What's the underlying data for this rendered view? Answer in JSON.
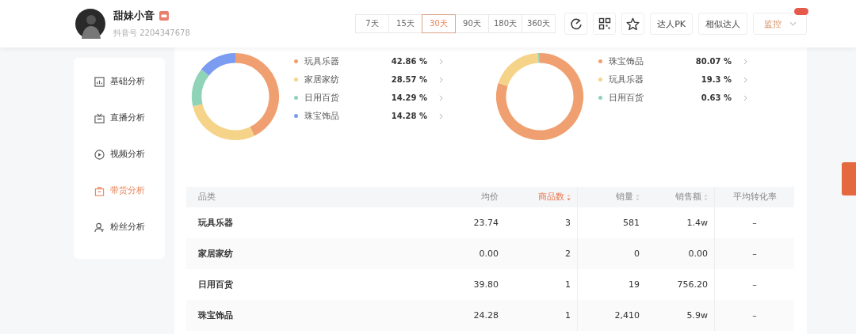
{
  "profile": {
    "name": "甜妹小音",
    "account": "抖音号 2204347678"
  },
  "periods": [
    {
      "label": "7天",
      "selected": false
    },
    {
      "label": "15天",
      "selected": false
    },
    {
      "label": "30天",
      "selected": true
    },
    {
      "label": "90天",
      "selected": false
    },
    {
      "label": "180天",
      "selected": false
    },
    {
      "label": "360天",
      "selected": false
    }
  ],
  "actions": [
    {
      "label": "达人PK"
    },
    {
      "label": "相似达人"
    }
  ],
  "monitor": {
    "label": "监控"
  },
  "sidebar": {
    "items": [
      {
        "label": "基础分析",
        "kind": "chart",
        "selected": false
      },
      {
        "label": "直播分析",
        "kind": "live",
        "selected": false
      },
      {
        "label": "视频分析",
        "kind": "video",
        "selected": false
      },
      {
        "label": "带货分析",
        "kind": "goods",
        "selected": true
      },
      {
        "label": "粉丝分析",
        "kind": "fans",
        "selected": false
      }
    ]
  },
  "charts": [
    {
      "chart_data": {
        "type": "donut",
        "categories": [
          "玩具乐器",
          "家居家纺",
          "日用百货",
          "珠宝饰品"
        ],
        "values": [
          42.86,
          28.57,
          14.29,
          14.28
        ]
      },
      "legend": [
        {
          "value": "42.86 %",
          "color": "#f0a070"
        },
        {
          "value": "28.57 %",
          "color": "#f5d388"
        },
        {
          "value": "14.29 %",
          "color": "#8fd3b8"
        },
        {
          "value": "14.28 %",
          "color": "#7b9cf0"
        }
      ]
    },
    {
      "chart_data": {
        "type": "donut",
        "categories": [
          "珠宝饰品",
          "玩具乐器",
          "日用百货"
        ],
        "values": [
          80.07,
          19.3,
          0.63
        ]
      },
      "legend": [
        {
          "value": "80.07 %",
          "color": "#f0a070"
        },
        {
          "value": "19.3 %",
          "color": "#f5d388"
        },
        {
          "value": "0.63 %",
          "color": "#8fd3b8"
        }
      ]
    }
  ],
  "table": {
    "columns": [
      {
        "label": "品类",
        "sortable": false,
        "selected": false
      },
      {
        "label": "均价",
        "sortable": false,
        "selected": false
      },
      {
        "label": "商品数",
        "sortable": true,
        "selected": true
      },
      {
        "label": "销量",
        "sortable": true,
        "selected": false
      },
      {
        "label": "销售额",
        "sortable": true,
        "selected": false
      },
      {
        "label": "平均转化率",
        "sortable": false,
        "selected": false
      }
    ],
    "rows": [
      [
        "玩具乐器",
        "23.74",
        "3",
        "581",
        "1.4w",
        "–"
      ],
      [
        "家居家纺",
        "0.00",
        "2",
        "0",
        "0.00",
        "–"
      ],
      [
        "日用百货",
        "39.80",
        "1",
        "19",
        "756.20",
        "–"
      ],
      [
        "珠宝饰品",
        "24.28",
        "1",
        "2,410",
        "5.9w",
        "–"
      ]
    ]
  }
}
